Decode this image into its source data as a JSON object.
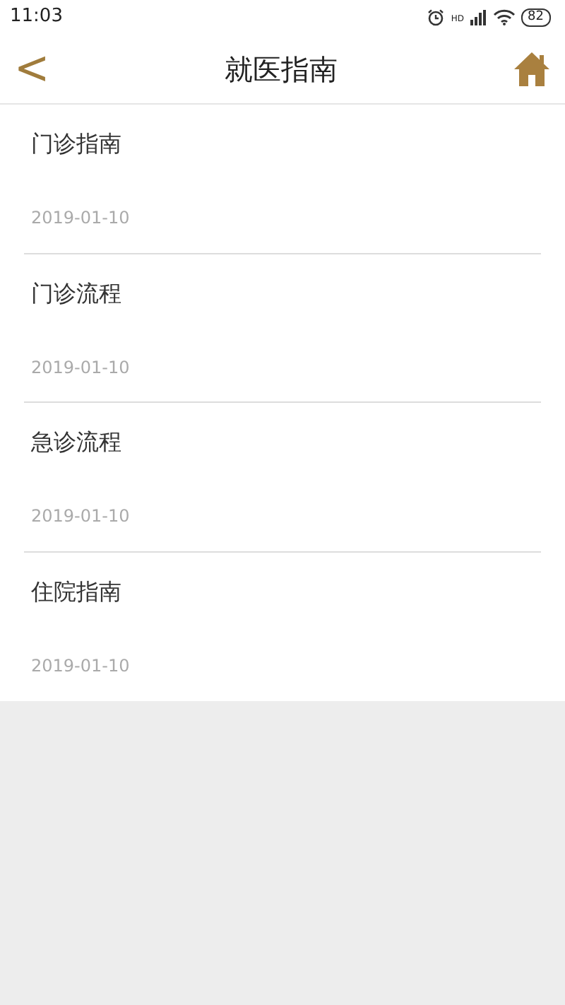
{
  "status_bar": {
    "time": "11:03",
    "network": "HD",
    "battery": "82"
  },
  "header": {
    "back": "<",
    "title": "就医指南"
  },
  "articles": [
    {
      "title": "门诊指南",
      "date": "2019-01-10"
    },
    {
      "title": "门诊流程",
      "date": "2019-01-10"
    },
    {
      "title": "急诊流程",
      "date": "2019-01-10"
    },
    {
      "title": "住院指南",
      "date": "2019-01-10"
    }
  ]
}
